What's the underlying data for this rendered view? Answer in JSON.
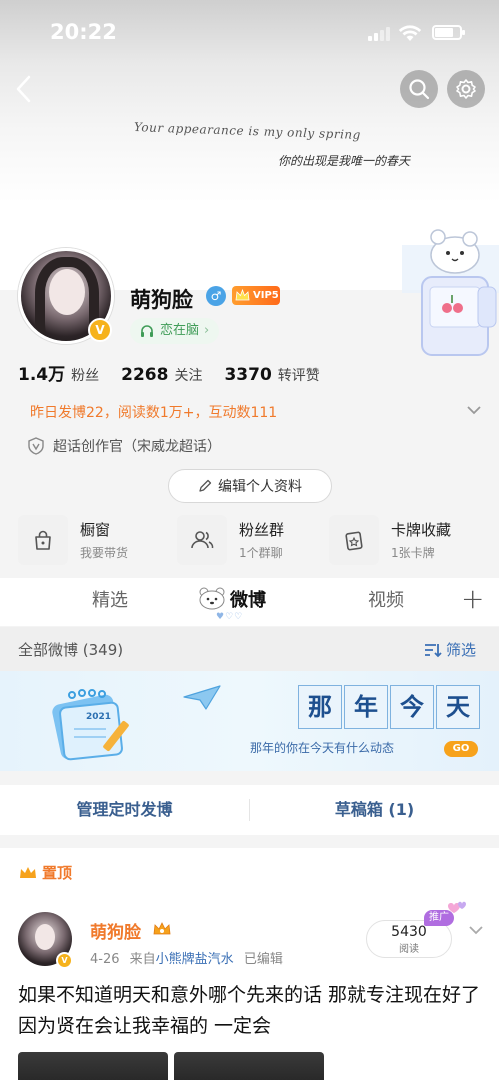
{
  "status_bar": {
    "time": "20:22"
  },
  "signature": {
    "english": "Your appearance is my only spring",
    "chinese": "你的出现是我唯一的春天"
  },
  "profile": {
    "name": "萌狗脸",
    "vip_label": "VIP5",
    "tag": "恋在脑",
    "stats": [
      {
        "num": "1.4万",
        "label": "粉丝"
      },
      {
        "num": "2268",
        "label": "关注"
      },
      {
        "num": "3370",
        "label": "转评赞"
      }
    ],
    "activity": "昨日发博22，阅读数1万+，互动数111",
    "creator": "超话创作官（宋威龙超话）",
    "edit_label": "编辑个人资料"
  },
  "shortcuts": [
    {
      "title": "橱窗",
      "sub": "我要带货",
      "icon": "shopping-bag-icon"
    },
    {
      "title": "粉丝群",
      "sub": "1个群聊",
      "icon": "group-icon"
    },
    {
      "title": "卡牌收藏",
      "sub": "1张卡牌",
      "icon": "card-icon"
    }
  ],
  "tabs": {
    "items": [
      "精选",
      "微博",
      "视频"
    ],
    "active": "微博",
    "hearts": "♥♡♡"
  },
  "filter": {
    "title": "全部微博 (349)",
    "button": "筛选"
  },
  "banner": {
    "chars": [
      "那",
      "年",
      "今",
      "天"
    ],
    "sub": "那年的你在今天有什么动态",
    "go": "GO",
    "cal_year": "2021"
  },
  "manage": {
    "scheduled": "管理定时发博",
    "drafts": "草稿箱 (1)"
  },
  "post": {
    "pinned": "置顶",
    "name": "萌狗脸",
    "date": "4-26",
    "from": "来自",
    "source": "小熊牌盐汽水",
    "edited": "已编辑",
    "reads": "5430",
    "reads_label": "阅读",
    "promo": "推广",
    "text": "如果不知道明天和意外哪个先来的话 那就专注现在好了 因为贤在会让我幸福的 一定会"
  },
  "colors": {
    "accent_orange": "#f07a2c",
    "link_blue": "#3a6fb5",
    "tag_green": "#3f9c57",
    "vip_orange": "#ff7a22"
  }
}
